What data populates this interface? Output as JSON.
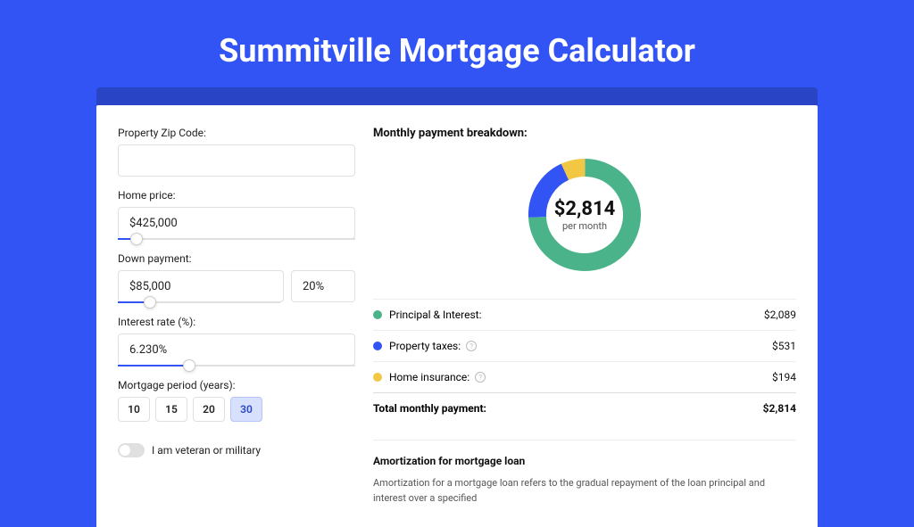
{
  "title": "Summitville Mortgage Calculator",
  "form": {
    "zip_label": "Property Zip Code:",
    "zip_value": "",
    "price_label": "Home price:",
    "price_value": "$425,000",
    "price_slider_pct": 8,
    "down_label": "Down payment:",
    "down_value": "$85,000",
    "down_pct_value": "20%",
    "down_slider_pct": 20,
    "rate_label": "Interest rate (%):",
    "rate_value": "6.230%",
    "rate_slider_pct": 30,
    "period_label": "Mortgage period (years):",
    "periods": [
      "10",
      "15",
      "20",
      "30"
    ],
    "period_active": "30",
    "veteran_label": "I am veteran or military"
  },
  "breakdown": {
    "title": "Monthly payment breakdown:",
    "center_amount": "$2,814",
    "center_sub": "per month",
    "items": [
      {
        "label": "Principal & Interest:",
        "value": "$2,089",
        "color": "#4BB38A",
        "info": false
      },
      {
        "label": "Property taxes:",
        "value": "$531",
        "color": "#3354F4",
        "info": true
      },
      {
        "label": "Home insurance:",
        "value": "$194",
        "color": "#F2C744",
        "info": true
      }
    ],
    "total_label": "Total monthly payment:",
    "total_value": "$2,814"
  },
  "amort": {
    "title": "Amortization for mortgage loan",
    "text": "Amortization for a mortgage loan refers to the gradual repayment of the loan principal and interest over a specified"
  },
  "chart_data": {
    "type": "pie",
    "title": "Monthly payment breakdown",
    "series": [
      {
        "name": "Principal & Interest",
        "value": 2089,
        "color": "#4BB38A"
      },
      {
        "name": "Property taxes",
        "value": 531,
        "color": "#3354F4"
      },
      {
        "name": "Home insurance",
        "value": 194,
        "color": "#F2C744"
      }
    ],
    "total": 2814,
    "center_label": "$2,814 per month"
  }
}
